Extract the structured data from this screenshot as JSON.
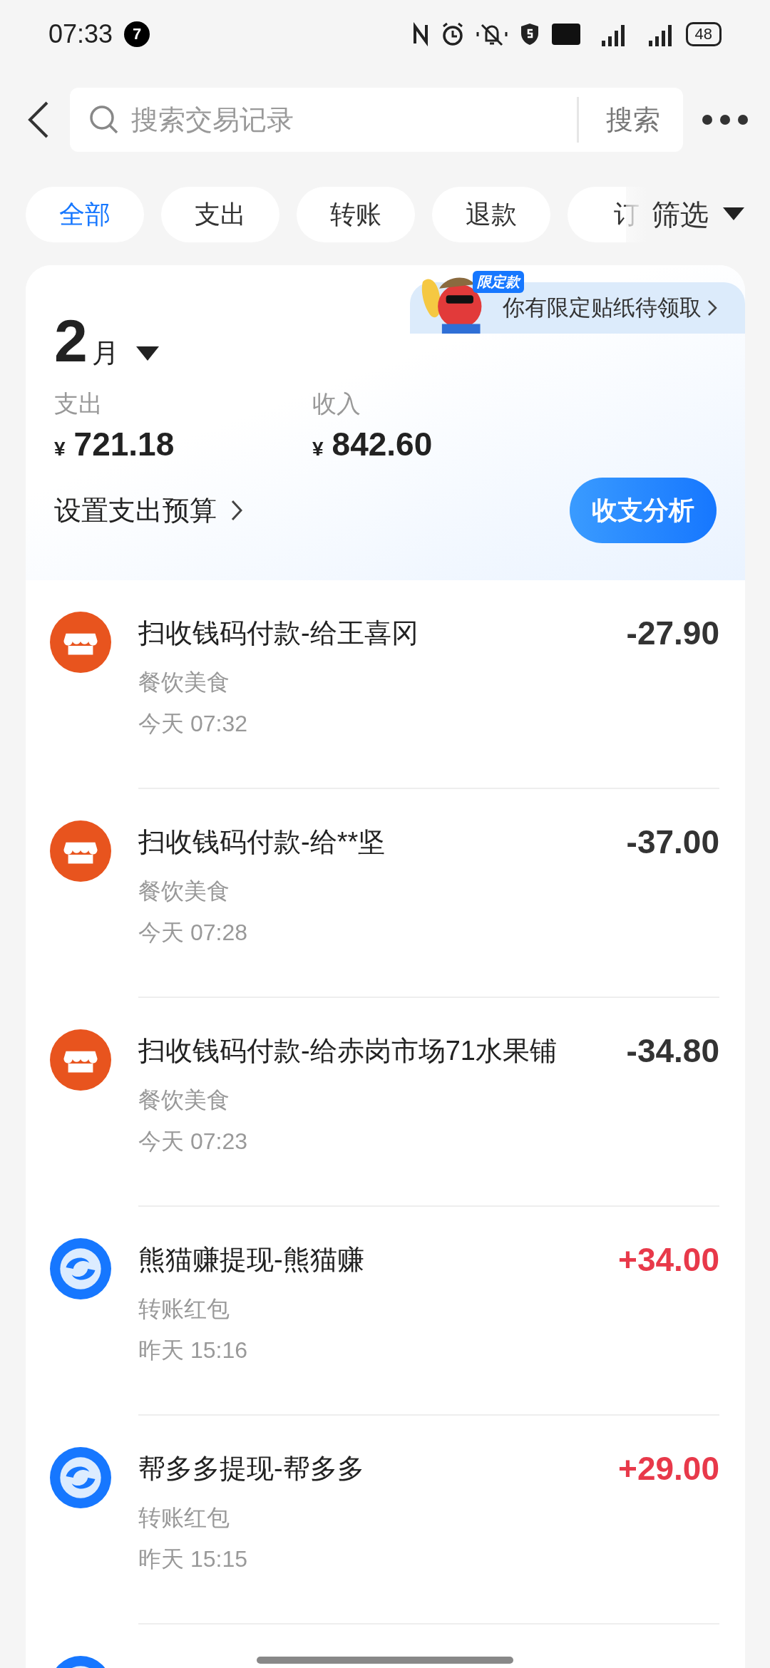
{
  "status_bar": {
    "time": "07:33",
    "notification_count": "7",
    "battery": "48"
  },
  "search": {
    "placeholder": "搜索交易记录",
    "button": "搜索"
  },
  "filters": [
    {
      "label": "全部",
      "selected": true
    },
    {
      "label": "支出",
      "selected": false
    },
    {
      "label": "转账",
      "selected": false
    },
    {
      "label": "退款",
      "selected": false
    },
    {
      "label": "订",
      "selected": false
    }
  ],
  "filter_menu": "筛选",
  "summary": {
    "month_number": "2",
    "month_unit": "月",
    "promo_badge": "限定款",
    "promo": "你有限定贴纸待领取",
    "expense_label": "支出",
    "expense_currency": "¥",
    "expense": "721.18",
    "income_label": "收入",
    "income_currency": "¥",
    "income": "842.60",
    "budget_link": "设置支出预算",
    "analysis_button": "收支分析"
  },
  "transactions": [
    {
      "kind": "expense",
      "title": "扫收钱码付款-给王喜冈",
      "category": "餐饮美食",
      "time": "今天 07:32",
      "amount": "-27.90"
    },
    {
      "kind": "expense",
      "title": "扫收钱码付款-给**坚",
      "category": "餐饮美食",
      "time": "今天 07:28",
      "amount": "-37.00"
    },
    {
      "kind": "expense",
      "title": "扫收钱码付款-给赤岗市场71水果铺",
      "category": "餐饮美食",
      "time": "今天 07:23",
      "amount": "-34.80"
    },
    {
      "kind": "income",
      "title": "熊猫赚提现-熊猫赚",
      "category": "转账红包",
      "time": "昨天 15:16",
      "amount": "+34.00"
    },
    {
      "kind": "income",
      "title": "帮多多提现-帮多多",
      "category": "转账红包",
      "time": "昨天 15:15",
      "amount": "+29.00"
    },
    {
      "kind": "income"
    }
  ]
}
